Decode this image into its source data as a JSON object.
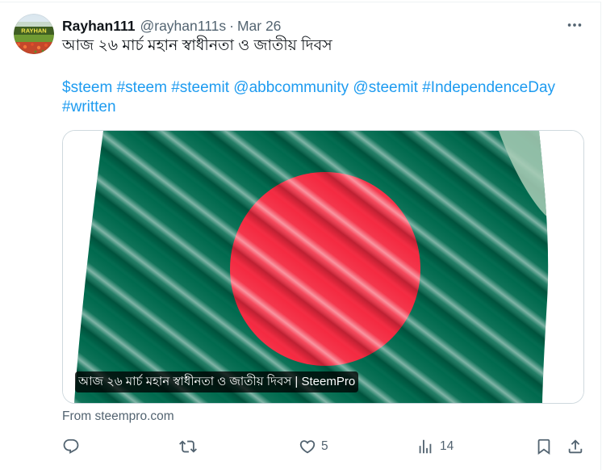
{
  "tweet": {
    "author": {
      "display_name": "Rayhan111",
      "handle": "@rayhan111s",
      "separator": "·",
      "date": "Mar 26",
      "avatar_label": "RAYHAN"
    },
    "more_icon": "more-horizontal-icon",
    "text": "আজ ২৬ মার্চ মহান স্বাধীনতা ও জাতীয় দিবস",
    "tags": [
      "$steem",
      "#steem",
      "#steemit",
      "@abbcommunity",
      "@steemit",
      "#IndependenceDay",
      "#written"
    ],
    "card": {
      "title": "আজ ২৬ মার্চ মহান স্বাধীনতা ও জাতীয় দিবস | SteemPro",
      "source": "From steempro.com"
    },
    "actions": {
      "reply": {
        "icon": "reply-icon"
      },
      "retweet": {
        "icon": "retweet-icon"
      },
      "like": {
        "icon": "heart-icon",
        "count": "5"
      },
      "views": {
        "icon": "views-icon",
        "count": "14"
      },
      "bookmark": {
        "icon": "bookmark-icon"
      },
      "share": {
        "icon": "share-icon"
      }
    }
  },
  "colors": {
    "text": "#0f1419",
    "secondary": "#536471",
    "link": "#1d9bf0",
    "border": "#cfd9de",
    "flag_green": "#006a4e",
    "flag_red": "#f42a41"
  }
}
